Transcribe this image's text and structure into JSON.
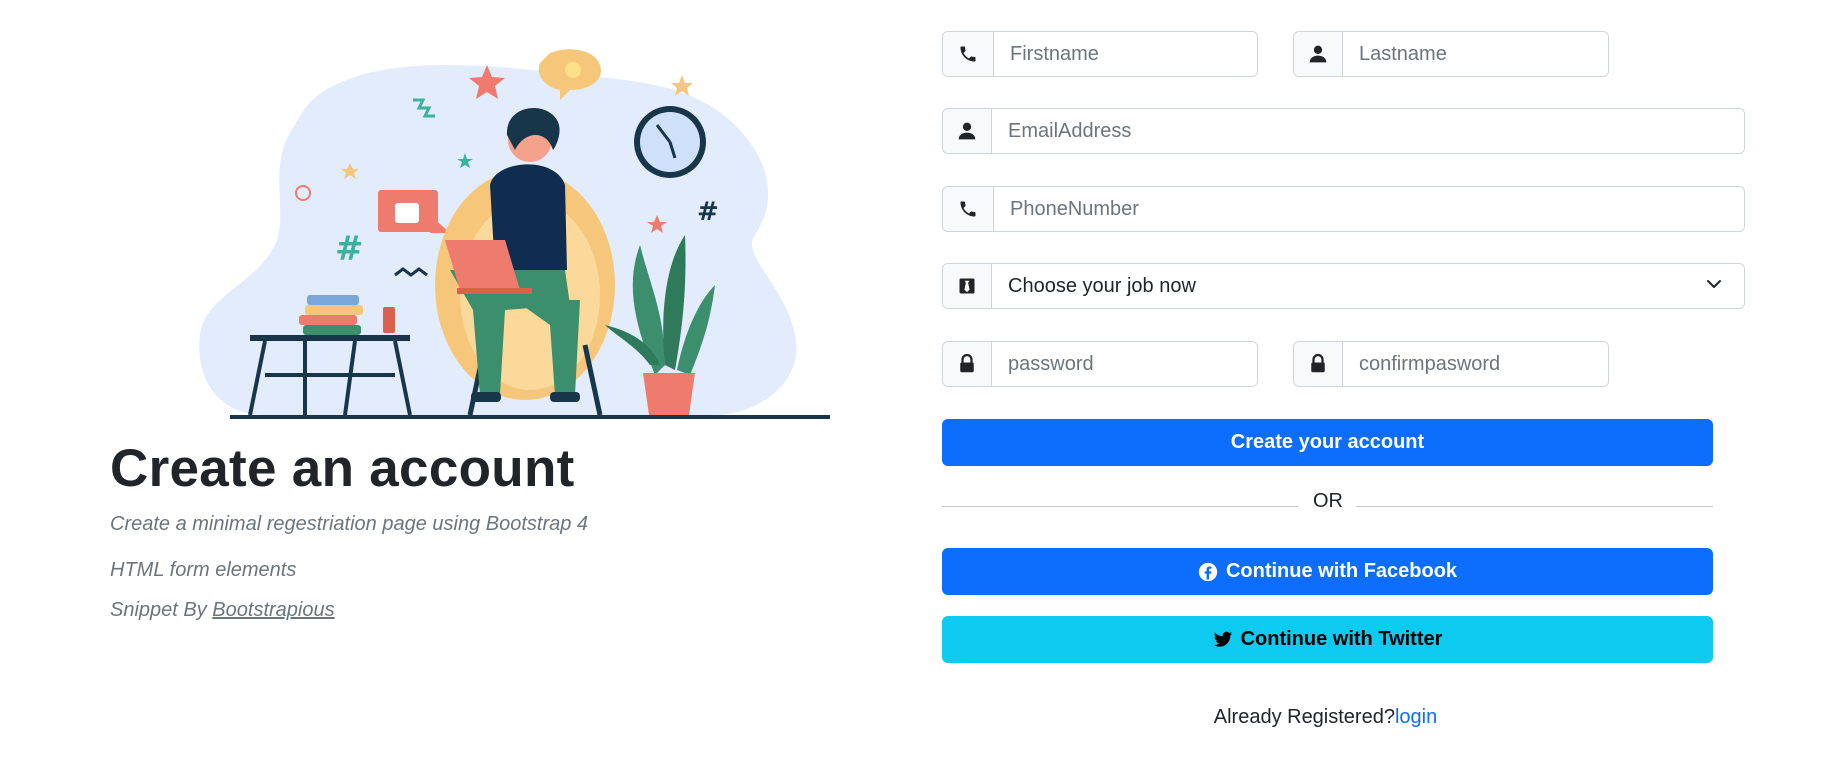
{
  "hero": {
    "title": "Create an account",
    "subtitle": "Create a minimal regestriation page using Bootstrap 4",
    "note": "HTML form elements",
    "snippet_prefix": "Snippet By ",
    "snippet_link": "Bootstrapious"
  },
  "form": {
    "firstname": {
      "placeholder": "Firstname",
      "icon": "phone-icon"
    },
    "lastname": {
      "placeholder": "Lastname",
      "icon": "user-icon"
    },
    "email": {
      "placeholder": "EmailAddress",
      "icon": "user-icon"
    },
    "phone": {
      "placeholder": "PhoneNumber",
      "icon": "phone-icon"
    },
    "job": {
      "selected": "Choose your job now",
      "icon": "black-tie-icon"
    },
    "password": {
      "placeholder": "password",
      "icon": "lock-icon"
    },
    "confirm": {
      "placeholder": "confirmpasword",
      "icon": "lock-icon"
    },
    "create_label": "Create your account",
    "or_label": "OR",
    "facebook_label": "Continue with Facebook",
    "twitter_label": "Continue with Twitter",
    "already_text": "Already Registered?",
    "login_label": "login"
  },
  "colors": {
    "primary": "#0d6efd",
    "info": "#0dcaf0",
    "muted": "#6c757d"
  }
}
